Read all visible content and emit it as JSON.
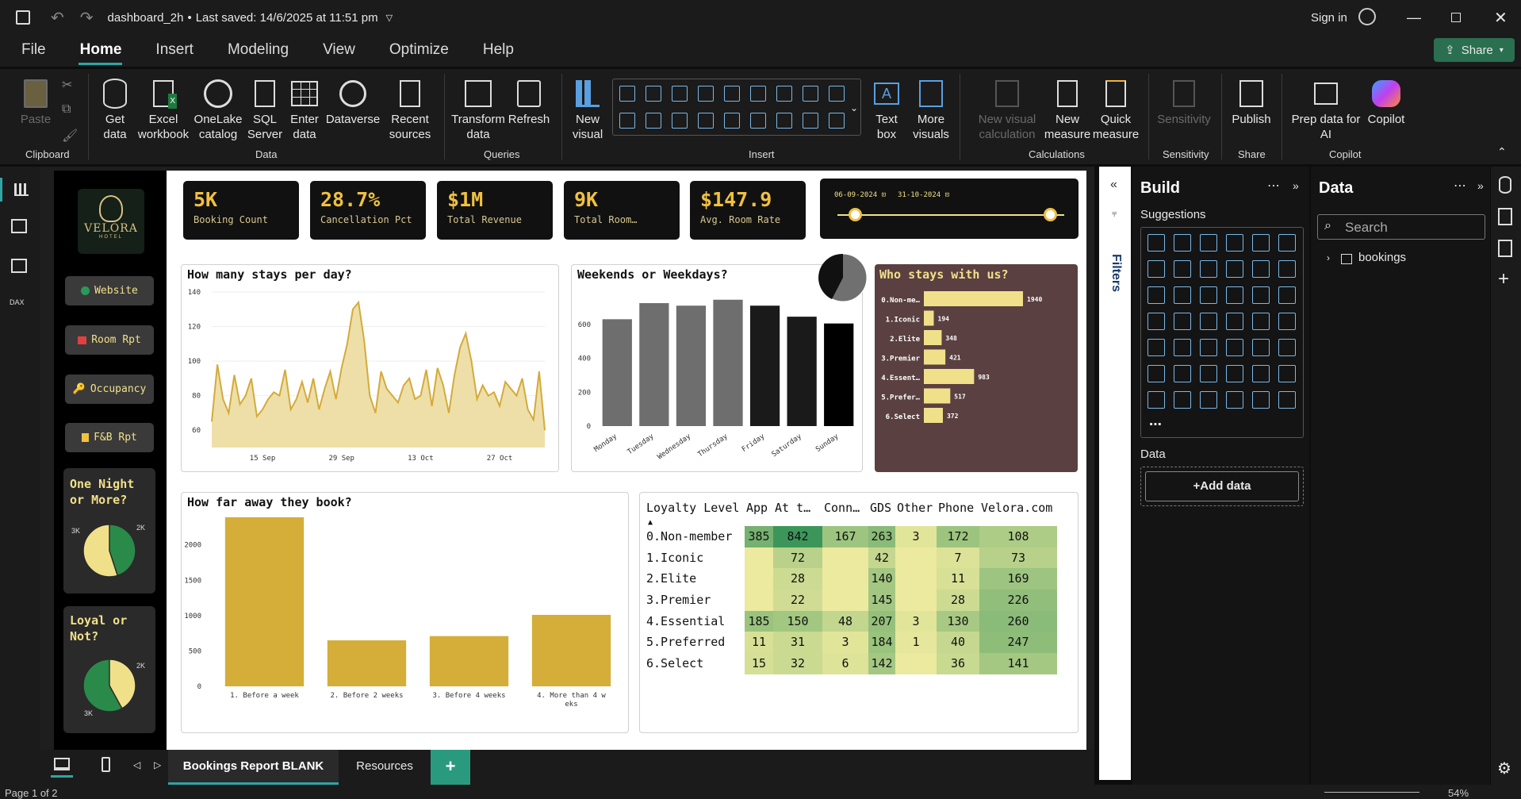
{
  "window": {
    "file_name": "dashboard_2h",
    "saved_status": "Last saved: 14/6/2025 at 11:51 pm",
    "sign_in": "Sign in",
    "share": "Share"
  },
  "menu": [
    "File",
    "Home",
    "Insert",
    "Modeling",
    "View",
    "Optimize",
    "Help"
  ],
  "ribbon": {
    "clipboard": {
      "paste": "Paste",
      "group": "Clipboard"
    },
    "data": {
      "get_data": "Get data",
      "excel": "Excel workbook",
      "onelake": "OneLake catalog",
      "sql": "SQL Server",
      "enter_data": "Enter data",
      "dataverse": "Dataverse",
      "recent": "Recent sources",
      "group": "Data"
    },
    "queries": {
      "transform": "Transform data",
      "refresh": "Refresh",
      "group": "Queries"
    },
    "insert": {
      "new_visual": "New visual",
      "text_box": "Text box",
      "more_visuals": "More visuals",
      "group": "Insert"
    },
    "calculations": {
      "new_visual_calc": "New visual calculation",
      "new_measure": "New measure",
      "quick_measure": "Quick measure",
      "group": "Calculations"
    },
    "sensitivity": {
      "label": "Sensitivity",
      "group": "Sensitivity"
    },
    "share": {
      "publish": "Publish",
      "group": "Share"
    },
    "copilot": {
      "prep": "Prep data for AI",
      "copilot": "Copilot",
      "group": "Copilot"
    }
  },
  "nav": {
    "logo_name": "VELORA",
    "logo_sub": "HOTEL",
    "buttons": [
      "Website",
      "Room Rpt",
      "Occupancy",
      "F&B Rpt"
    ],
    "pie1_title": "One Night or More?",
    "pie1_labels": [
      "3K",
      "2K"
    ],
    "pie2_title": "Loyal or Not?",
    "pie2_labels": [
      "2K",
      "3K"
    ]
  },
  "kpis": [
    {
      "value": "5K",
      "label": "Booking Count"
    },
    {
      "value": "28.7%",
      "label": "Cancellation Pct"
    },
    {
      "value": "$1M",
      "label": "Total Revenue"
    },
    {
      "value": "9K",
      "label": "Total Room…"
    },
    {
      "value": "$147.9",
      "label": "Avg. Room Rate"
    }
  ],
  "slicer": {
    "start": "06-09-2024",
    "end": "31-10-2024"
  },
  "charts": {
    "stays": "How many stays per day?",
    "weekends": "Weekends or Weekdays?",
    "who": "Who stays with us?",
    "far": "How far away they book?"
  },
  "chart_data": [
    {
      "type": "area",
      "title": "How many stays per day?",
      "x_ticks": [
        "15 Sep",
        "29 Sep",
        "13 Oct",
        "27 Oct"
      ],
      "ylim": [
        50,
        140
      ],
      "y_ticks": [
        60,
        80,
        100,
        120,
        140
      ],
      "values": [
        65,
        98,
        78,
        70,
        92,
        75,
        80,
        90,
        68,
        72,
        78,
        82,
        80,
        95,
        72,
        78,
        88,
        76,
        90,
        72,
        84,
        94,
        78,
        96,
        110,
        130,
        134,
        112,
        80,
        70,
        94,
        84,
        80,
        76,
        86,
        90,
        78,
        80,
        95,
        74,
        96,
        86,
        70,
        92,
        108,
        116,
        100,
        78,
        86,
        80,
        82,
        74,
        88,
        84,
        80,
        90,
        72,
        66,
        94,
        60
      ]
    },
    {
      "type": "bar",
      "title": "Weekends or Weekdays?",
      "categories": [
        "Monday",
        "Tuesday",
        "Wednesday",
        "Thursday",
        "Friday",
        "Saturday",
        "Sunday"
      ],
      "values": [
        630,
        725,
        710,
        745,
        710,
        645,
        605
      ],
      "ylim": [
        0,
        800
      ],
      "y_ticks": [
        0,
        200,
        400,
        600
      ],
      "colors": [
        "#6e6e6e",
        "#6e6e6e",
        "#6e6e6e",
        "#6e6e6e",
        "#1a1a1a",
        "#1a1a1a",
        "#000000"
      ]
    },
    {
      "type": "bar",
      "title": "Who stays with us?",
      "categories": [
        "0.Non-me…",
        "1.Iconic",
        "2.Elite",
        "3.Premier",
        "4.Essent…",
        "5.Prefer…",
        "6.Select"
      ],
      "values": [
        1940,
        194,
        348,
        421,
        983,
        517,
        372
      ]
    },
    {
      "type": "bar",
      "title": "How far away they book?",
      "categories": [
        "1. Before a week",
        "2. Before 2 weeks",
        "3. Before 4 weeks",
        "4. More than 4 weeks"
      ],
      "values": [
        2390,
        650,
        710,
        1010
      ],
      "ylim": [
        0,
        2400
      ],
      "y_ticks": [
        0,
        500,
        1000,
        1500,
        2000
      ]
    },
    {
      "type": "table",
      "title": "Loyalty matrix",
      "columns": [
        "Loyalty Level",
        "App",
        "At t…",
        "Conn…",
        "GDS",
        "Other",
        "Phone",
        "Velora.com"
      ],
      "rows": [
        [
          "0.Non-member",
          "385",
          "842",
          "167",
          "263",
          "3",
          "172",
          "108"
        ],
        [
          "1.Iconic",
          "",
          "72",
          "",
          "42",
          "",
          "7",
          "73"
        ],
        [
          "2.Elite",
          "",
          "28",
          "",
          "140",
          "",
          "11",
          "169"
        ],
        [
          "3.Premier",
          "",
          "22",
          "",
          "145",
          "",
          "28",
          "226"
        ],
        [
          "4.Essential",
          "185",
          "150",
          "48",
          "207",
          "3",
          "130",
          "260"
        ],
        [
          "5.Preferred",
          "11",
          "31",
          "3",
          "184",
          "1",
          "40",
          "247"
        ],
        [
          "6.Select",
          "15",
          "32",
          "6",
          "142",
          "",
          "36",
          "141"
        ]
      ]
    }
  ],
  "panes": {
    "filters": "Filters",
    "build": "Build",
    "suggestions": "Suggestions",
    "data_section": "Data",
    "add_data": "+Add data",
    "data_title": "Data",
    "search_placeholder": "Search",
    "table": "bookings"
  },
  "tabs": [
    "Bookings Report BLANK",
    "Resources"
  ],
  "status": {
    "page": "Page 1 of 2",
    "zoom": "54%"
  }
}
